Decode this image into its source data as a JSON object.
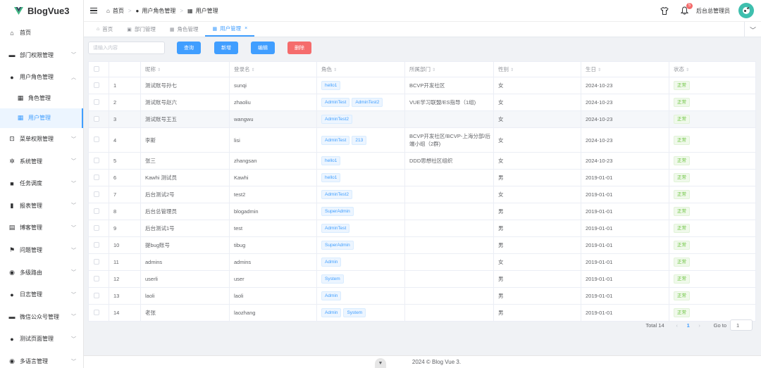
{
  "app": {
    "title": "BlogVue3"
  },
  "sidebar": {
    "items": [
      {
        "label": "首页",
        "icon": "home-icon"
      },
      {
        "label": "部门权限管理",
        "icon": "briefcase-icon"
      },
      {
        "label": "用户角色管理",
        "icon": "user-icon"
      },
      {
        "label": "角色管理",
        "icon": "grid-icon"
      },
      {
        "label": "用户管理",
        "icon": "grid-icon"
      },
      {
        "label": "菜单权限管理",
        "icon": "lock-icon"
      },
      {
        "label": "系统管理",
        "icon": "gear-icon"
      },
      {
        "label": "任务调度",
        "icon": "video-icon"
      },
      {
        "label": "报表管理",
        "icon": "bar-chart-icon"
      },
      {
        "label": "博客管理",
        "icon": "clipboard-icon"
      },
      {
        "label": "问题管理",
        "icon": "flag-icon"
      },
      {
        "label": "多级路由",
        "icon": "globe-icon"
      },
      {
        "label": "日志管理",
        "icon": "user-icon"
      },
      {
        "label": "微信公众号管理",
        "icon": "briefcase-icon"
      },
      {
        "label": "测试页面管理",
        "icon": "info-icon"
      },
      {
        "label": "多语言管理",
        "icon": "globe-icon"
      }
    ]
  },
  "header": {
    "breadcrumb": [
      "首页",
      "用户角色管理",
      "用户管理"
    ],
    "notification_count": "5",
    "user_name": "后台总管理员"
  },
  "tabs": [
    {
      "label": "首页",
      "icon": "home-icon"
    },
    {
      "label": "部门管理",
      "icon": "doc-icon"
    },
    {
      "label": "角色管理",
      "icon": "grid-icon"
    },
    {
      "label": "用户管理",
      "icon": "grid-icon",
      "active": true
    }
  ],
  "toolbar": {
    "search_placeholder": "请输入内容",
    "query_label": "查询",
    "add_label": "新增",
    "edit_label": "编辑",
    "delete_label": "删除"
  },
  "table": {
    "headers": [
      "昵称",
      "登录名",
      "角色",
      "所属部门",
      "性别",
      "生日",
      "状态"
    ],
    "rows": [
      {
        "idx": "1",
        "nick": "测试账号孙七",
        "login": "sunqi",
        "roles": [
          "hello1"
        ],
        "dept": "BCVP开发社区",
        "gender": "女",
        "birthday": "2024-10-23",
        "status": "正常"
      },
      {
        "idx": "2",
        "nick": "测试账号赵六",
        "login": "zhaoliu",
        "roles": [
          "AdminTest",
          "AdminTest2"
        ],
        "dept": "VUE学习联盟/ES指导（1组)",
        "gender": "女",
        "birthday": "2024-10-23",
        "status": "正常"
      },
      {
        "idx": "3",
        "nick": "测试账号王五",
        "login": "wangwu",
        "roles": [
          "AdminTest2"
        ],
        "dept": "",
        "gender": "女",
        "birthday": "2024-10-23",
        "status": "正常"
      },
      {
        "idx": "4",
        "nick": "李斯",
        "login": "lisi",
        "roles": [
          "AdminTest",
          "213"
        ],
        "dept": "BCVP开发社区/BCVP-上海分部/后端小组（2群)",
        "gender": "女",
        "birthday": "2024-10-23",
        "status": "正常"
      },
      {
        "idx": "5",
        "nick": "张三",
        "login": "zhangsan",
        "roles": [
          "hello1"
        ],
        "dept": "DDD思想社区组织",
        "gender": "女",
        "birthday": "2024-10-23",
        "status": "正常"
      },
      {
        "idx": "6",
        "nick": "Kawhi 测试员",
        "login": "Kawhi",
        "roles": [
          "hello1"
        ],
        "dept": "",
        "gender": "男",
        "birthday": "2019-01-01",
        "status": "正常"
      },
      {
        "idx": "7",
        "nick": "后台测试2号",
        "login": "test2",
        "roles": [
          "AdminTest2"
        ],
        "dept": "",
        "gender": "女",
        "birthday": "2019-01-01",
        "status": "正常"
      },
      {
        "idx": "8",
        "nick": "后台总管理员",
        "login": "blogadmin",
        "roles": [
          "SuperAdmin"
        ],
        "dept": "",
        "gender": "男",
        "birthday": "2019-01-01",
        "status": "正常"
      },
      {
        "idx": "9",
        "nick": "后台测试1号",
        "login": "test",
        "roles": [
          "AdminTest"
        ],
        "dept": "",
        "gender": "男",
        "birthday": "2019-01-01",
        "status": "正常"
      },
      {
        "idx": "10",
        "nick": "提bug账号",
        "login": "tibug",
        "roles": [
          "SuperAdmin"
        ],
        "dept": "",
        "gender": "男",
        "birthday": "2019-01-01",
        "status": "正常"
      },
      {
        "idx": "11",
        "nick": "admins",
        "login": "admins",
        "roles": [
          "Admin"
        ],
        "dept": "",
        "gender": "女",
        "birthday": "2019-01-01",
        "status": "正常"
      },
      {
        "idx": "12",
        "nick": "userli",
        "login": "user",
        "roles": [
          "System"
        ],
        "dept": "",
        "gender": "男",
        "birthday": "2019-01-01",
        "status": "正常"
      },
      {
        "idx": "13",
        "nick": "laoli",
        "login": "laoli",
        "roles": [
          "Admin"
        ],
        "dept": "",
        "gender": "男",
        "birthday": "2019-01-01",
        "status": "正常"
      },
      {
        "idx": "14",
        "nick": "老张",
        "login": "laozhang",
        "roles": [
          "Admin",
          "System"
        ],
        "dept": "",
        "gender": "男",
        "birthday": "2019-01-01",
        "status": "正常"
      }
    ]
  },
  "pagination": {
    "total": "Total 14",
    "current_page": "1",
    "goto_label": "Go to",
    "goto_value": "1"
  },
  "footer": {
    "text": "2024 © Blog Vue 3."
  },
  "colors": {
    "primary": "#409eff",
    "danger": "#f56c6c",
    "success": "#67c23a"
  }
}
